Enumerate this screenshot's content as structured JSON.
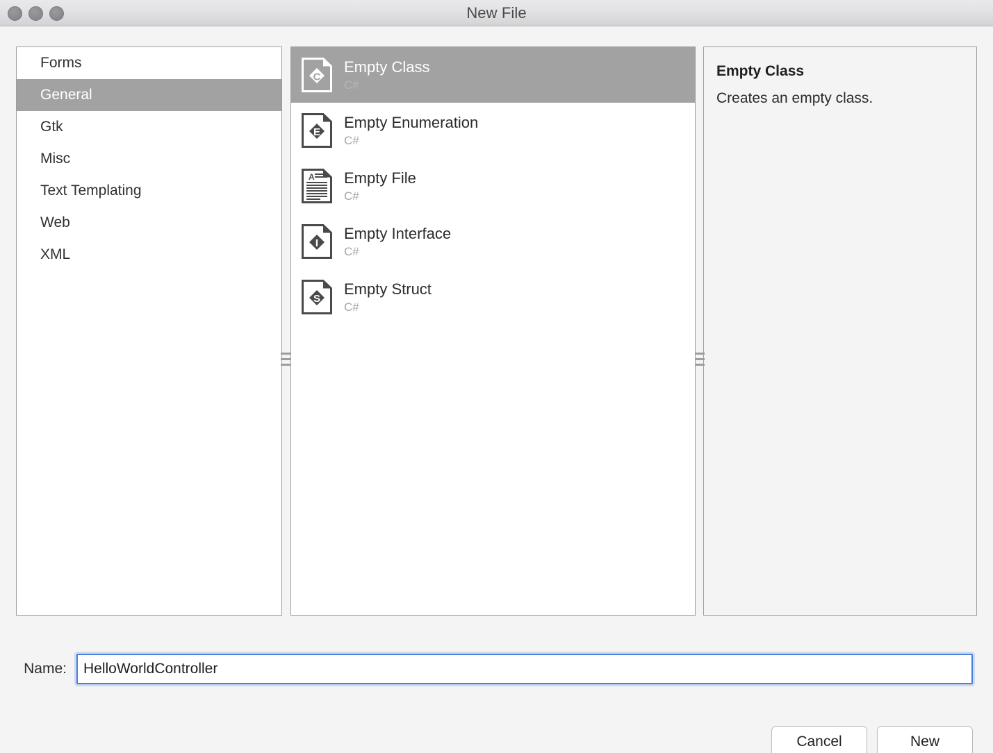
{
  "window": {
    "title": "New File",
    "traffic_lights": [
      "close",
      "minimize",
      "maximize"
    ]
  },
  "categories": {
    "selected": "General",
    "items": [
      {
        "label": "Forms"
      },
      {
        "label": "General"
      },
      {
        "label": "Gtk"
      },
      {
        "label": "Misc"
      },
      {
        "label": "Text Templating"
      },
      {
        "label": "Web"
      },
      {
        "label": "XML"
      }
    ]
  },
  "templates": {
    "selected": "Empty Class",
    "items": [
      {
        "title": "Empty Class",
        "subtitle": "C#",
        "icon": "csharp-class-file-icon",
        "glyph": "C"
      },
      {
        "title": "Empty Enumeration",
        "subtitle": "C#",
        "icon": "csharp-enum-file-icon",
        "glyph": "E"
      },
      {
        "title": "Empty File",
        "subtitle": "C#",
        "icon": "text-file-icon",
        "glyph": "A"
      },
      {
        "title": "Empty Interface",
        "subtitle": "C#",
        "icon": "csharp-interface-file-icon",
        "glyph": "I"
      },
      {
        "title": "Empty Struct",
        "subtitle": "C#",
        "icon": "csharp-struct-file-icon",
        "glyph": "S"
      }
    ]
  },
  "details": {
    "title": "Empty Class",
    "description": "Creates an empty class."
  },
  "name_field": {
    "label": "Name:",
    "value": "HelloWorldController",
    "placeholder": ""
  },
  "footer": {
    "cancel_label": "Cancel",
    "new_label": "New"
  },
  "colors": {
    "selection": "#a2a2a2",
    "focus_border": "#4a7fdc",
    "pane_border": "#9d9d9d",
    "dialog_bg": "#f4f4f4",
    "details_bg": "#f4f4f4"
  }
}
